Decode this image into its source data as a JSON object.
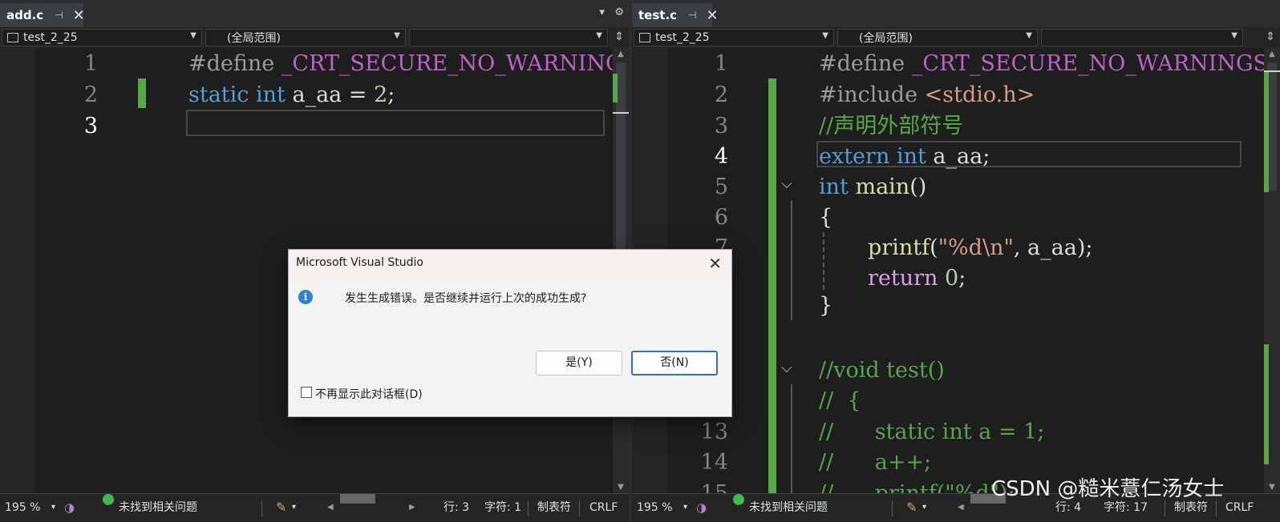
{
  "left_pane": {
    "tab": {
      "name": "add.c",
      "pin_icon": "pin-icon",
      "close_icon": "close-icon"
    },
    "nav": {
      "project": "test_2_25",
      "scope": "(全局范围)",
      "member": ""
    },
    "lines": [
      "1",
      "2",
      "3"
    ],
    "code": {
      "l1_directive": "#define",
      "l1_macro": "_CRT_SECURE_NO_WARNINGS",
      "l2_static": "static",
      "l2_int": "int",
      "l2_rest": "a_aa = ",
      "l2_num": "2",
      "l2_end": ";"
    },
    "status": {
      "zoom": "195 %",
      "issues": "未找到相关问题",
      "line": "行: 3",
      "char": "字符: 1",
      "tab": "制表符",
      "eol": "CRLF"
    }
  },
  "right_pane": {
    "tab": {
      "name": "test.c"
    },
    "nav": {
      "project": "test_2_25",
      "scope": "(全局范围)",
      "member": ""
    },
    "lines": [
      "1",
      "2",
      "3",
      "4",
      "5",
      "6",
      "7",
      "",
      "",
      "",
      "",
      "",
      "13",
      "14",
      "15"
    ],
    "code": {
      "l1_directive": "#define",
      "l1_macro": "_CRT_SECURE_NO_WARNINGS",
      "l2_directive": "#include",
      "l2_header": "<stdio.h>",
      "l3_comment": "//声明外部符号",
      "l4_extern": "extern",
      "l4_int": "int",
      "l4_rest": "a_aa;",
      "l5_int": "int",
      "l5_main": "main",
      "l5_paren": "()",
      "l6_brace": "{",
      "l7_printf": "printf",
      "l7_open": "(",
      "l7_str": "\"%d\\n\"",
      "l7_rest": ", a_aa);",
      "l8_return": "return",
      "l8_num": "0",
      "l8_end": ";",
      "l9_brace": "}",
      "l11_comment": "//void test()",
      "l12_comment": "//  {",
      "l13_comment": "//      static int a = 1;",
      "l14_comment": "//      a++;",
      "l15_comment": "//      printf(\"%d\");"
    },
    "status": {
      "zoom": "195 %",
      "issues": "未找到相关问题",
      "line": "行: 4",
      "char": "字符: 17",
      "tab": "制表符",
      "eol": "CRLF"
    }
  },
  "dialog": {
    "title": "Microsoft Visual Studio",
    "message": "发生生成错误。是否继续并运行上次的成功生成?",
    "yes_label": "是(Y)",
    "no_label": "否(N)",
    "checkbox_label": "不再显示此对话框(D)",
    "checked": false,
    "icon": "info-icon"
  },
  "watermark": "CSDN @糙米薏仁汤女士",
  "colors": {
    "editor_bg": "#1e1e1e",
    "keyword": "#569cd6",
    "macro": "#bd63c5",
    "comment": "#57a64a",
    "string": "#d69d85",
    "function": "#dcdcaa",
    "change_marker": "#57a64a",
    "dialog_primary": "#2f6fc7"
  }
}
